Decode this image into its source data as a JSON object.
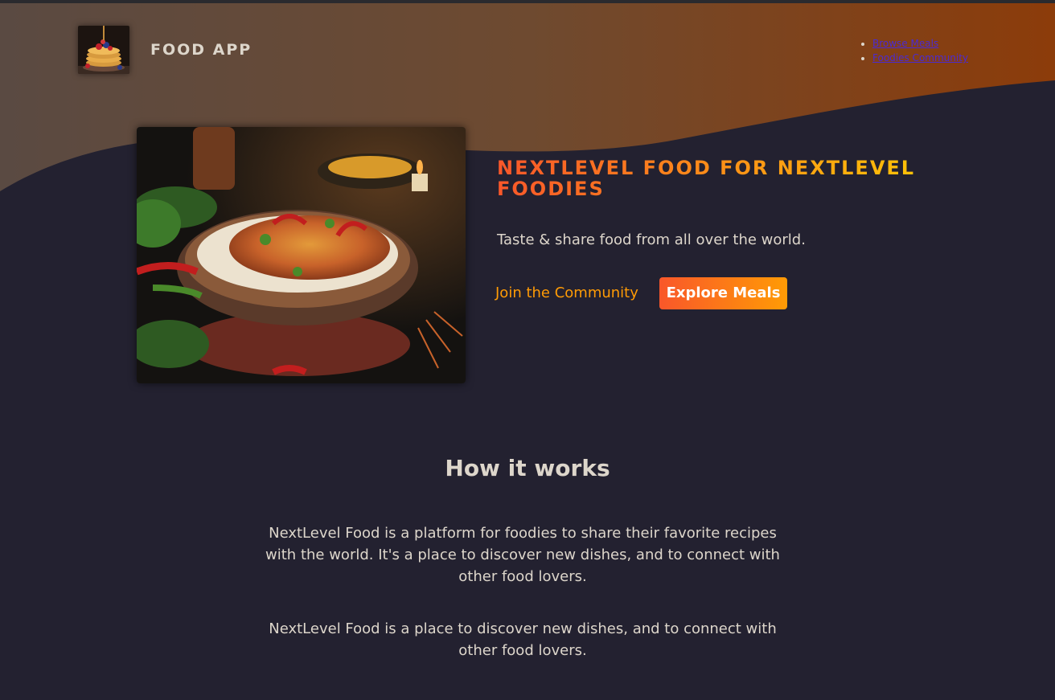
{
  "header": {
    "logo_text": "FOOD APP",
    "nav": [
      {
        "label": "Browse Meals"
      },
      {
        "label": "Foodies Community"
      }
    ]
  },
  "hero": {
    "title": "NEXTLEVEL FOOD FOR NEXTLEVEL FOODIES",
    "tagline": "Taste & share food from all over the world.",
    "community_link": "Join the Community",
    "explore_button": "Explore Meals"
  },
  "how_it_works": {
    "title": "How it works",
    "paragraphs": [
      "NextLevel Food is a platform for foodies to share their favorite recipes with the world. It's a place to discover new dishes, and to connect with other food lovers.",
      "NextLevel Food is a place to discover new dishes, and to connect with other food lovers."
    ]
  },
  "colors": {
    "background": "#232130",
    "accent_start": "#f9572a",
    "accent_end": "#ff9b05",
    "title_gradient_end": "#ffc905",
    "text": "#ddd6cb",
    "nav_link": "#4a2ad4"
  },
  "icons": {
    "logo": "pancake-stack-logo",
    "hero_image": "curry-dish-photo"
  }
}
